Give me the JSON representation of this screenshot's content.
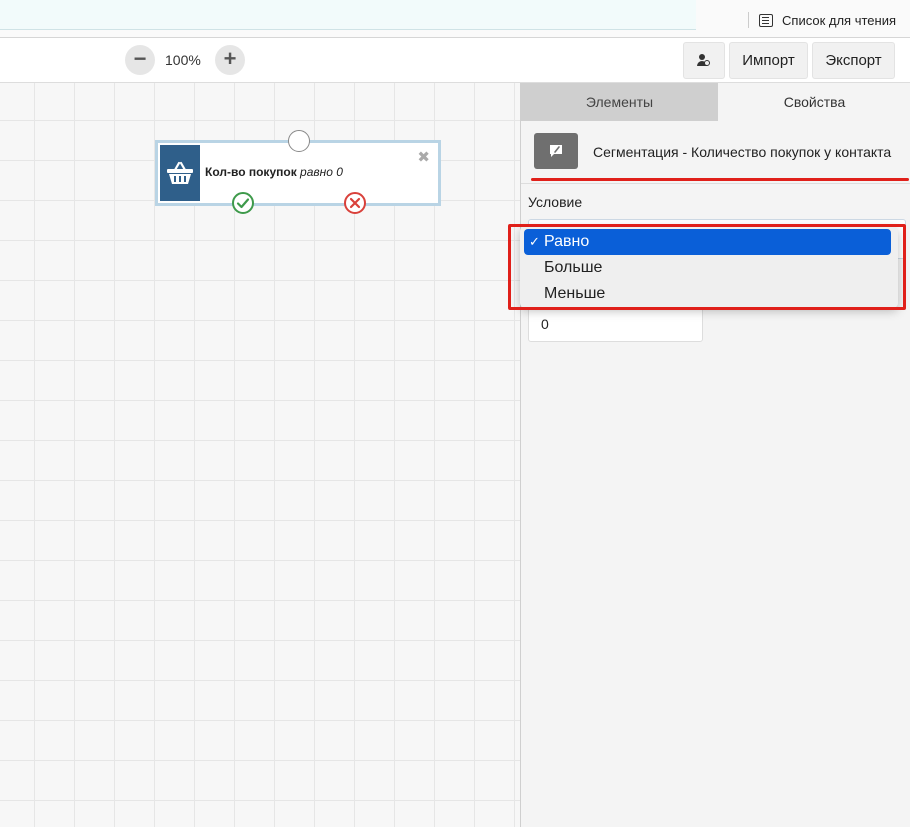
{
  "browser": {
    "reading_list_label": "Список для чтения",
    "reading_list_icon": "reading-list-icon"
  },
  "toolbar": {
    "zoom_out_icon": "minus-icon",
    "zoom_out_label": "−",
    "zoom_value": "100%",
    "zoom_in_icon": "plus-icon",
    "zoom_in_label": "+",
    "contacts_icon": "user-search-icon",
    "import_label": "Импорт",
    "export_label": "Экспорт"
  },
  "canvas": {
    "node": {
      "icon": "basket-icon",
      "title": "Кол-во покупок",
      "condition_text": "равно 0",
      "close_label": "✖",
      "yes_icon": "check-circle-icon",
      "no_icon": "x-circle-icon"
    }
  },
  "panel": {
    "tabs": [
      {
        "label": "Элементы",
        "active": false
      },
      {
        "label": "Свойства",
        "active": true
      }
    ],
    "element": {
      "icon": "segmentation-icon",
      "title": "Сегментация - Количество покупок у контакта"
    },
    "condition_label": "Условие",
    "value": "0"
  },
  "dropdown": {
    "options": [
      {
        "label": "Равно",
        "selected": true,
        "check": "✓"
      },
      {
        "label": "Больше",
        "selected": false
      },
      {
        "label": "Меньше",
        "selected": false
      }
    ]
  },
  "colors": {
    "node_accent": "#2f5f8a",
    "yes": "#3e9a4b",
    "no": "#d9413b",
    "selected_option": "#0a5fd8",
    "highlight": "#e0201a"
  }
}
